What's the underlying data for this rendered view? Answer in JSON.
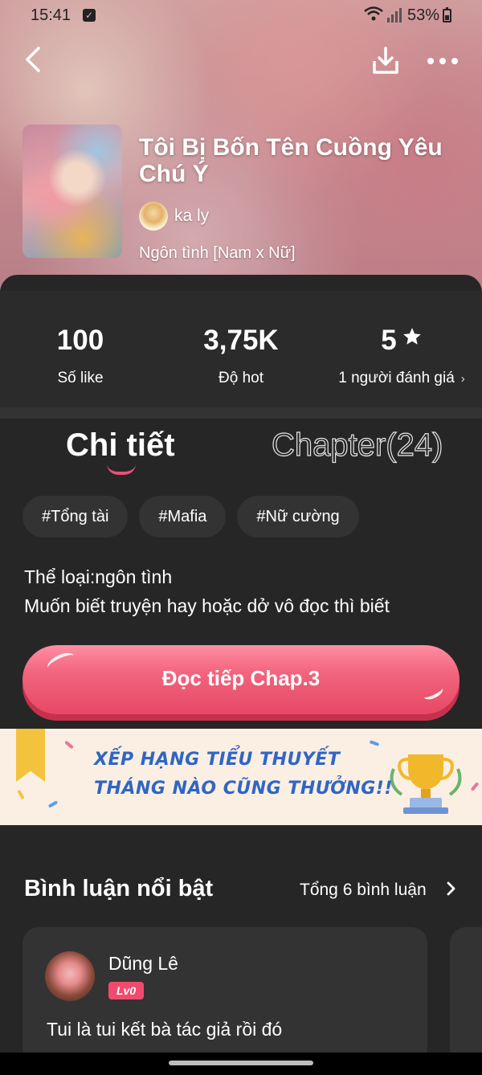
{
  "status_bar": {
    "time": "15:41",
    "battery": "53%"
  },
  "story": {
    "title": "Tôi Bị Bốn Tên Cuồng Yêu Chú Ý",
    "author": "ka ly",
    "genre": "Ngôn tình [Nam x Nữ]"
  },
  "stats": {
    "likes": {
      "value": "100",
      "label": "Số like"
    },
    "hot": {
      "value": "3,75K",
      "label": "Độ hot"
    },
    "rating": {
      "value": "5",
      "label": "1 người đánh giá"
    }
  },
  "tabs": {
    "detail": "Chi tiết",
    "chapter": "Chapter(24)"
  },
  "tags": [
    "#Tổng tài",
    "#Mafia",
    "#Nữ cường"
  ],
  "description": {
    "line1": "Thể loại:ngôn tình",
    "line2": "Muốn biết truyện hay hoặc dở vô đọc thì biết"
  },
  "read_button": "Đọc tiếp Chap.3",
  "banner": {
    "line1": "XẾP HẠNG TIỂU THUYẾT",
    "line2": "THÁNG NÀO CŨNG THƯỞNG!!"
  },
  "comments": {
    "title": "Bình luận nổi bật",
    "total": "Tổng 6 bình luận",
    "items": [
      {
        "name": "Dũng Lê",
        "level": "Lv0",
        "text": "Tui là tui kết bà tác giả rồi đó"
      }
    ]
  },
  "colors": {
    "accent": "#f04b6f",
    "background": "#262626",
    "banner_text": "#2f66c4"
  }
}
